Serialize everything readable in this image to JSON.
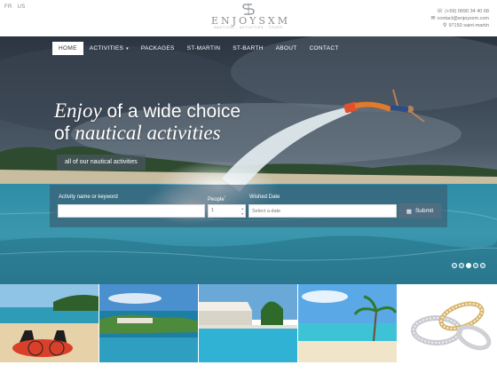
{
  "header": {
    "languages": [
      "FR",
      "US"
    ],
    "logo": {
      "name": "ENJOYSXM",
      "tagline": "NAUTICAL · ACTIVITIES · TOURS"
    },
    "contact": {
      "phone": "(+59) 0690 34 40 68",
      "email": "contact@enjoysxm.com",
      "address": "97150 saint-martin"
    }
  },
  "nav": {
    "items": [
      {
        "label": "HOME",
        "active": true
      },
      {
        "label": "ACTIVITIES",
        "has_dropdown": true
      },
      {
        "label": "PACKAGES"
      },
      {
        "label": "ST-MARTIN"
      },
      {
        "label": "ST-BARTH"
      },
      {
        "label": "ABOUT"
      },
      {
        "label": "CONTACT"
      }
    ]
  },
  "hero": {
    "line1_italic": "Enjoy",
    "line1_rest": " of a wide choice",
    "line2_plain": "of ",
    "line2_italic": "nautical activities",
    "cta_label": "all of our nautical activities"
  },
  "search": {
    "activity_label": "Activity name or keyword",
    "activity_value": "",
    "people_label": "People",
    "people_required_mark": "*",
    "people_value": "1",
    "date_label": "Wished Date",
    "date_placeholder": "Select a date",
    "submit_label": "Submit"
  },
  "slider": {
    "total_slides": 5,
    "active_index": 2
  },
  "colors": {
    "brand_grey": "#8a8f93",
    "overlay": "#3c5064",
    "sea": "#2f8ea6"
  }
}
